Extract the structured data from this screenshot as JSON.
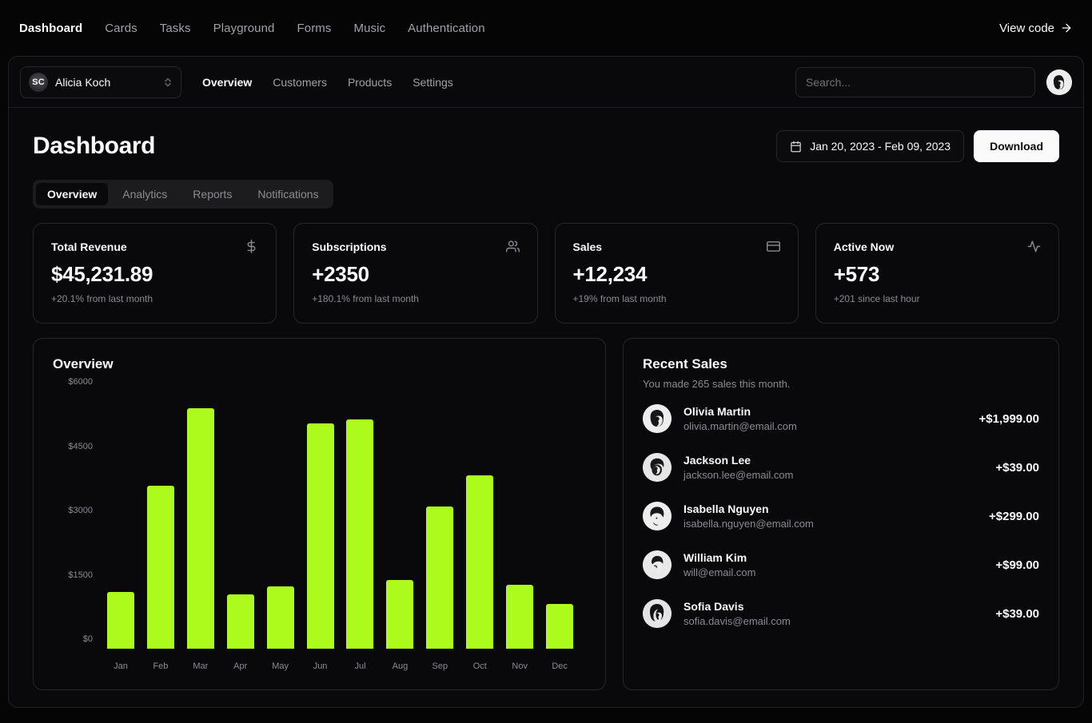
{
  "topnav": {
    "links": [
      {
        "label": "Dashboard",
        "active": true
      },
      {
        "label": "Cards",
        "active": false
      },
      {
        "label": "Tasks",
        "active": false
      },
      {
        "label": "Playground",
        "active": false
      },
      {
        "label": "Forms",
        "active": false
      },
      {
        "label": "Music",
        "active": false
      },
      {
        "label": "Authentication",
        "active": false
      }
    ],
    "view_code_label": "View code",
    "view_code_icon": "arrow-right-icon"
  },
  "subnav": {
    "team": {
      "initials": "SC",
      "name": "Alicia Koch",
      "selector_icon": "chevron-up-down-icon"
    },
    "links": [
      {
        "label": "Overview",
        "active": true
      },
      {
        "label": "Customers",
        "active": false
      },
      {
        "label": "Products",
        "active": false
      },
      {
        "label": "Settings",
        "active": false
      }
    ],
    "search": {
      "placeholder": "Search...",
      "value": ""
    },
    "avatar_icon": "user-avatar"
  },
  "page": {
    "title": "Dashboard",
    "date_range": {
      "label": "Jan 20, 2023 - Feb 09, 2023",
      "icon": "calendar-icon"
    },
    "download_label": "Download",
    "tabs": [
      {
        "label": "Overview",
        "active": true
      },
      {
        "label": "Analytics",
        "active": false
      },
      {
        "label": "Reports",
        "active": false
      },
      {
        "label": "Notifications",
        "active": false
      }
    ]
  },
  "stats": [
    {
      "label": "Total Revenue",
      "value": "$45,231.89",
      "sub": "+20.1% from last month",
      "icon": "dollar-sign-icon"
    },
    {
      "label": "Subscriptions",
      "value": "+2350",
      "sub": "+180.1% from last month",
      "icon": "users-icon"
    },
    {
      "label": "Sales",
      "value": "+12,234",
      "sub": "+19% from last month",
      "icon": "credit-card-icon"
    },
    {
      "label": "Active Now",
      "value": "+573",
      "sub": "+201 since last hour",
      "icon": "activity-icon"
    }
  ],
  "overview_panel": {
    "title": "Overview"
  },
  "recent_sales": {
    "title": "Recent Sales",
    "subtitle": "You made 265 sales this month.",
    "rows": [
      {
        "name": "Olivia Martin",
        "email": "olivia.martin@email.com",
        "amount": "+$1,999.00"
      },
      {
        "name": "Jackson Lee",
        "email": "jackson.lee@email.com",
        "amount": "+$39.00"
      },
      {
        "name": "Isabella Nguyen",
        "email": "isabella.nguyen@email.com",
        "amount": "+$299.00"
      },
      {
        "name": "William Kim",
        "email": "will@email.com",
        "amount": "+$99.00"
      },
      {
        "name": "Sofia Davis",
        "email": "sofia.davis@email.com",
        "amount": "+$39.00"
      }
    ]
  },
  "colors": {
    "accent": "#adfa1d",
    "background": "#09090b",
    "border": "#27272a",
    "muted_text": "#8b8b93",
    "foreground": "#fafafa"
  },
  "chart_data": {
    "type": "bar",
    "title": "Overview",
    "xlabel": "",
    "ylabel": "",
    "categories": [
      "Jan",
      "Feb",
      "Mar",
      "Apr",
      "May",
      "Jun",
      "Jul",
      "Aug",
      "Sep",
      "Oct",
      "Nov",
      "Dec"
    ],
    "values": [
      1320,
      3800,
      5610,
      1270,
      1460,
      5260,
      5340,
      1600,
      3310,
      4050,
      1500,
      1050
    ],
    "ylim": [
      0,
      6000
    ],
    "yticks": [
      0,
      1500,
      3000,
      4500,
      6000
    ],
    "ytick_labels": [
      "$0",
      "$1500",
      "$3000",
      "$4500",
      "$6000"
    ],
    "grid": false,
    "legend": false,
    "bar_color": "#adfa1d"
  }
}
